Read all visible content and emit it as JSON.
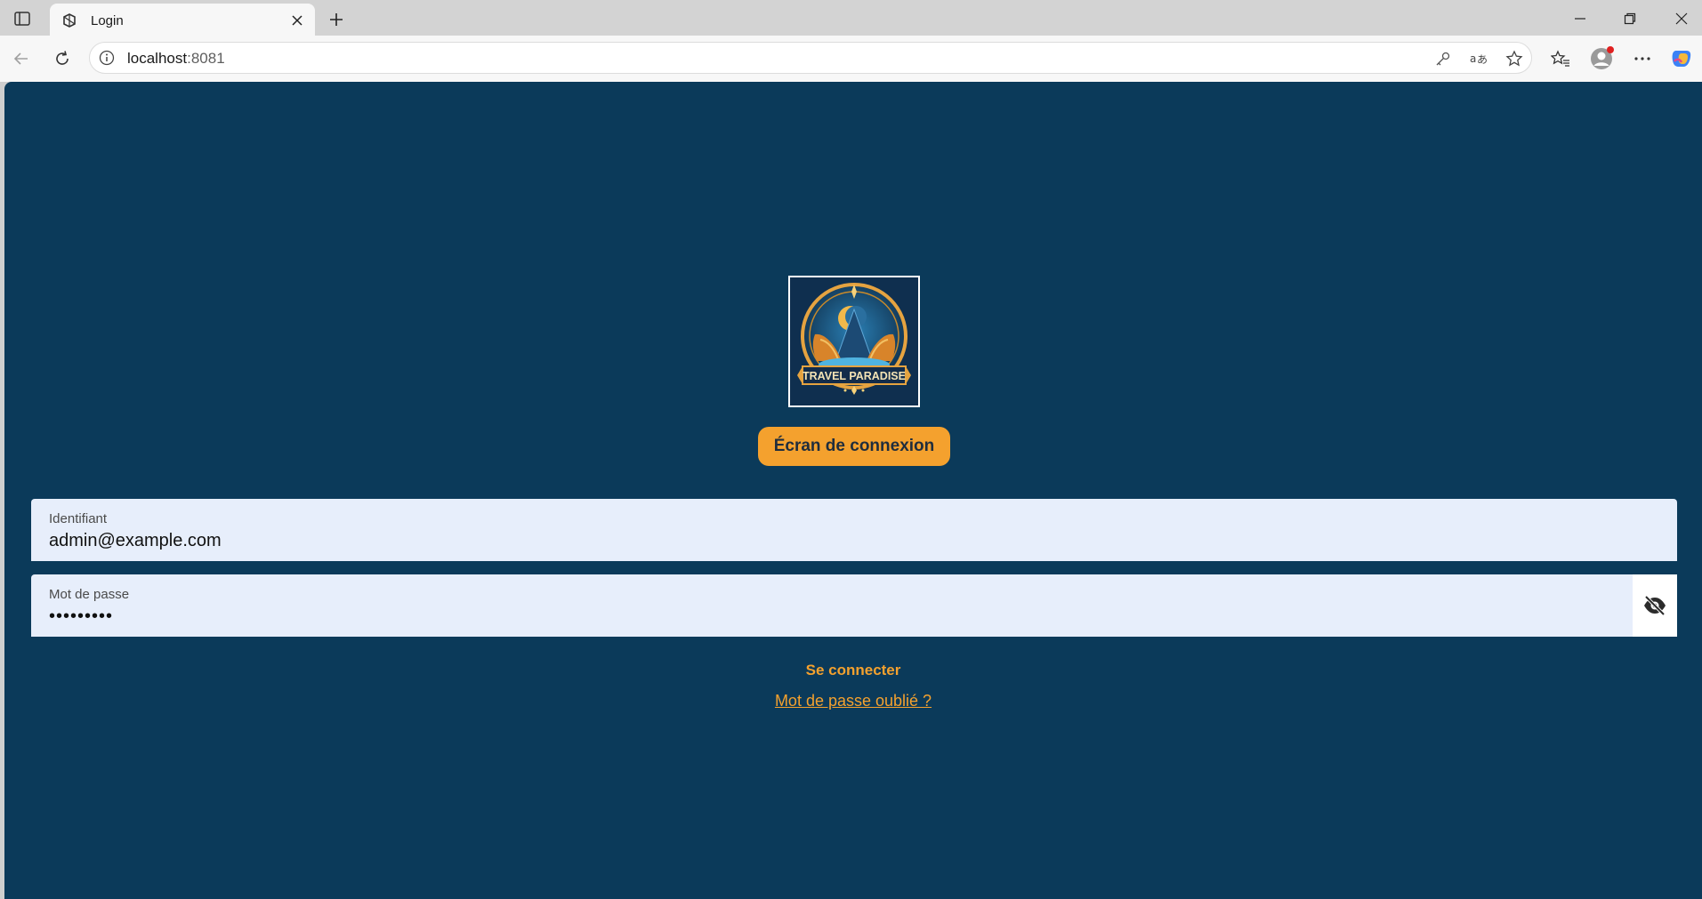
{
  "browser": {
    "tab_title": "Login",
    "url_host": "localhost",
    "url_port": ":8081"
  },
  "page": {
    "logo_text": "TRAVEL PARADISE",
    "screen_title": "Écran de connexion",
    "username": {
      "label": "Identifiant",
      "value": "admin@example.com"
    },
    "password": {
      "label": "Mot de passe",
      "masked_value": "•••••••••"
    },
    "login_button": "Se connecter",
    "forgot_link": "Mot de passe oublié ?"
  },
  "colors": {
    "background": "#0b3a5a",
    "accent": "#f4a12e",
    "field_background": "#e7eefb"
  },
  "icons": [
    "sidebar-toggle-icon",
    "favicon-icon",
    "close-icon",
    "plus-icon",
    "minimize-icon",
    "restore-icon",
    "back-icon",
    "refresh-icon",
    "info-icon",
    "key-icon",
    "translate-icon",
    "star-icon",
    "favorites-icon",
    "profile-icon",
    "more-icon",
    "copilot-icon",
    "eye-off-icon"
  ]
}
